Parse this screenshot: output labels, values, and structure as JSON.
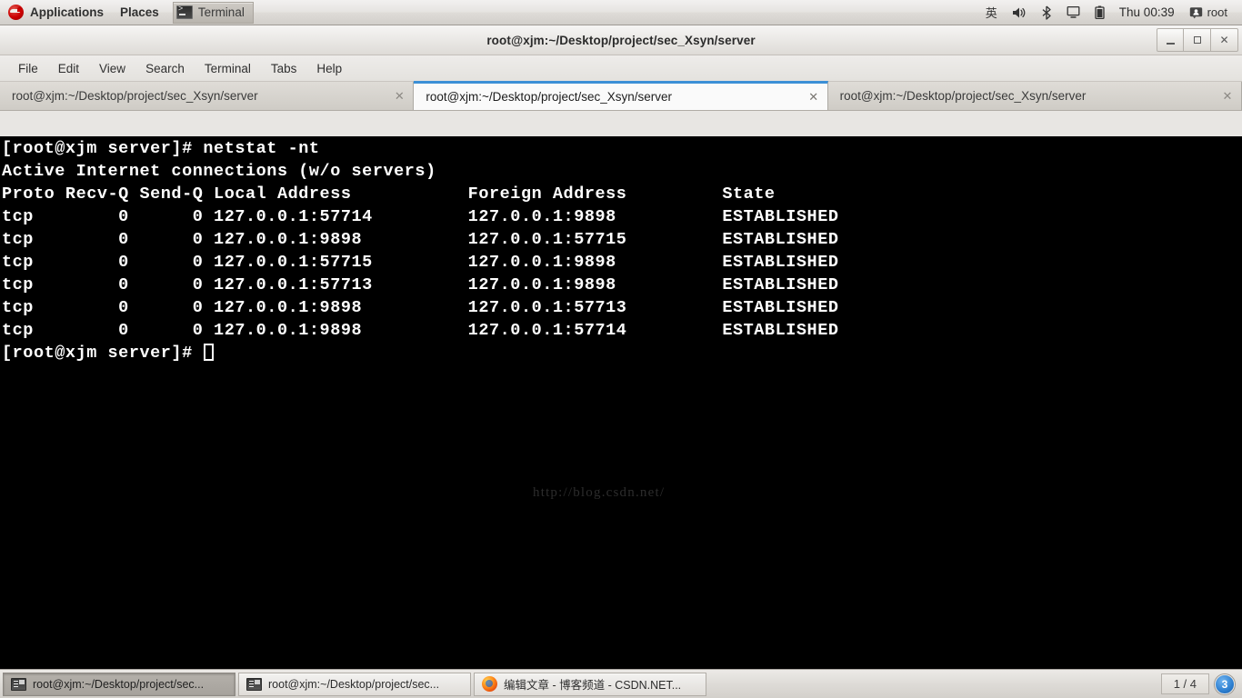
{
  "top_panel": {
    "applications_label": "Applications",
    "places_label": "Places",
    "window_button_label": "Terminal",
    "tray": {
      "input_method": "英",
      "volume_icon": "volume-icon",
      "bluetooth_icon": "bluetooth-icon",
      "display_icon": "display-icon",
      "battery_icon": "battery-icon",
      "clock": "Thu 00:39",
      "user_icon": "user-icon",
      "user_label": "root"
    }
  },
  "window": {
    "title": "root@xjm:~/Desktop/project/sec_Xsyn/server",
    "controls": {
      "minimize": "minimize-button",
      "maximize": "maximize-button",
      "close": "✕"
    },
    "menu": [
      "File",
      "Edit",
      "View",
      "Search",
      "Terminal",
      "Tabs",
      "Help"
    ],
    "tabs": [
      {
        "label": "root@xjm:~/Desktop/project/sec_Xsyn/server",
        "active": false,
        "close": "✕"
      },
      {
        "label": "root@xjm:~/Desktop/project/sec_Xsyn/server",
        "active": true,
        "close": "✕"
      },
      {
        "label": "root@xjm:~/Desktop/project/sec_Xsyn/server",
        "active": false,
        "close": "✕"
      }
    ]
  },
  "terminal": {
    "prompt": "[root@xjm server]#",
    "command": "netstat -nt",
    "lines": [
      "[root@xjm server]# netstat -nt",
      "Active Internet connections (w/o servers)",
      "Proto Recv-Q Send-Q Local Address           Foreign Address         State",
      "tcp        0      0 127.0.0.1:57714         127.0.0.1:9898          ESTABLISHED",
      "tcp        0      0 127.0.0.1:9898          127.0.0.1:57715         ESTABLISHED",
      "tcp        0      0 127.0.0.1:57715         127.0.0.1:9898          ESTABLISHED",
      "tcp        0      0 127.0.0.1:57713         127.0.0.1:9898          ESTABLISHED",
      "tcp        0      0 127.0.0.1:9898          127.0.0.1:57713         ESTABLISHED",
      "tcp        0      0 127.0.0.1:9898          127.0.0.1:57714         ESTABLISHED"
    ],
    "last_prompt": "[root@xjm server]# ",
    "table": {
      "headers": [
        "Proto",
        "Recv-Q",
        "Send-Q",
        "Local Address",
        "Foreign Address",
        "State"
      ],
      "rows": [
        [
          "tcp",
          "0",
          "0",
          "127.0.0.1:57714",
          "127.0.0.1:9898",
          "ESTABLISHED"
        ],
        [
          "tcp",
          "0",
          "0",
          "127.0.0.1:9898",
          "127.0.0.1:57715",
          "ESTABLISHED"
        ],
        [
          "tcp",
          "0",
          "0",
          "127.0.0.1:57715",
          "127.0.0.1:9898",
          "ESTABLISHED"
        ],
        [
          "tcp",
          "0",
          "0",
          "127.0.0.1:57713",
          "127.0.0.1:9898",
          "ESTABLISHED"
        ],
        [
          "tcp",
          "0",
          "0",
          "127.0.0.1:9898",
          "127.0.0.1:57713",
          "ESTABLISHED"
        ],
        [
          "tcp",
          "0",
          "0",
          "127.0.0.1:9898",
          "127.0.0.1:57714",
          "ESTABLISHED"
        ]
      ]
    },
    "watermark": "http://blog.csdn.net/",
    "colors": {
      "background": "#000000",
      "foreground": "#ffffff"
    }
  },
  "bottom_panel": {
    "tasks": [
      {
        "label": "root@xjm:~/Desktop/project/sec...",
        "icon": "terminal-icon",
        "active": true
      },
      {
        "label": "root@xjm:~/Desktop/project/sec...",
        "icon": "terminal-icon",
        "active": false
      },
      {
        "label": "编辑文章 - 博客频道 - CSDN.NET...",
        "icon": "firefox-icon",
        "active": false
      }
    ],
    "workspace_pager": "1 / 4",
    "workspace_badge": "3"
  },
  "colors": {
    "accent": "#3b8fd6",
    "panel": "#dedbd7",
    "terminal_bg": "#000000"
  }
}
